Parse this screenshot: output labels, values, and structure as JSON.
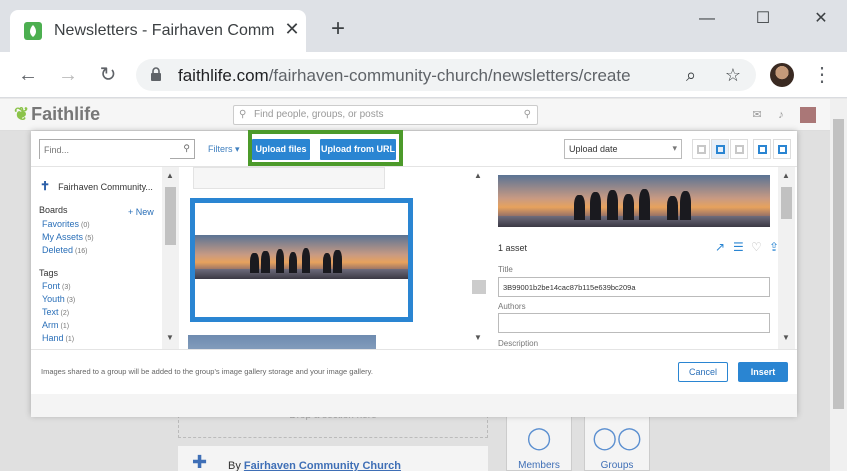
{
  "browser": {
    "tab_title": "Newsletters - Fairhaven Community Church",
    "tab_close": "✕",
    "new_tab": "+",
    "url_host": "faithlife.com",
    "url_path": "/fairhaven-community-church/newsletters/create",
    "window": {
      "minimize": "—",
      "maximize": "☐",
      "close": "✕"
    }
  },
  "faithlife": {
    "logo": "Faithlife",
    "search_placeholder": "Find people, groups, or posts"
  },
  "modal": {
    "find_placeholder": "Find...",
    "filters_label": "Filters ▾",
    "upload_files": "Upload files",
    "upload_url": "Upload from URL",
    "sort_value": "Upload date",
    "sidebar": {
      "group_name": "Fairhaven Community...",
      "boards_title": "Boards",
      "new_label": "+ New",
      "boards": [
        {
          "label": "Favorites",
          "count": "(0)"
        },
        {
          "label": "My Assets",
          "count": "(5)"
        },
        {
          "label": "Deleted",
          "count": "(16)"
        }
      ],
      "tags_title": "Tags",
      "tags": [
        {
          "label": "Font",
          "count": "(3)"
        },
        {
          "label": "Youth",
          "count": "(3)"
        },
        {
          "label": "Text",
          "count": "(2)"
        },
        {
          "label": "Arm",
          "count": "(1)"
        },
        {
          "label": "Hand",
          "count": "(1)"
        }
      ]
    },
    "details": {
      "asset_count": "1 asset",
      "title_label": "Title",
      "title_value": "3B99001b2be14cac87b115e639bc209a",
      "authors_label": "Authors",
      "authors_value": "",
      "description_label": "Description"
    },
    "footer_note": "Images shared to a group will be added to the group's image gallery storage and your image gallery.",
    "cancel_label": "Cancel",
    "insert_label": "Insert"
  },
  "page": {
    "drop_section": "Drop a section here",
    "byline_prefix": "By ",
    "byline_author": "Fairhaven Community Church",
    "members_label": "Members",
    "groups_label": "Groups"
  },
  "colors": {
    "accent": "#2a85d2",
    "highlight": "#4c9a2a",
    "brand_green": "#8bc34a"
  },
  "icons": [
    "leaf-icon",
    "lock-icon",
    "search-icon",
    "star-icon",
    "chevron-down-icon",
    "grid-view-icon",
    "list-view-icon",
    "share-icon",
    "heart-icon",
    "download-icon",
    "edit-icon",
    "members-icon",
    "groups-icon"
  ]
}
